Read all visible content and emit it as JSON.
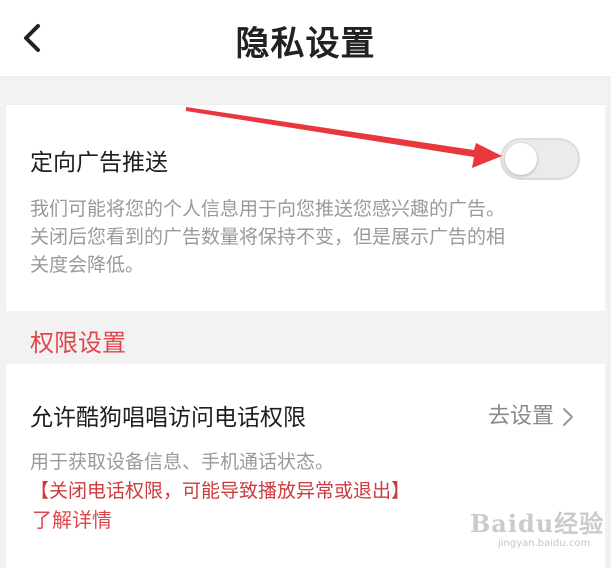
{
  "header": {
    "title": "隐私设置",
    "back_icon": "chevron-left-icon"
  },
  "ad_push": {
    "title": "定向广告推送",
    "toggle_on": false,
    "description_line1": "我们可能将您的个人信息用于向您推送您感兴趣的广告。",
    "description_line2": "关闭后您看到的广告数量将保持不变，但是展示广告的相",
    "description_line3": "关度会降低。"
  },
  "permissions_section": {
    "label": "权限设置",
    "label_color": "#e0474c"
  },
  "phone_permission": {
    "title": "允许酷狗唱唱访问电话权限",
    "action_label": "去设置",
    "action_icon": "chevron-right-icon",
    "description": "用于获取设备信息、手机通话状态。",
    "warning": "【关闭电话权限，可能导致播放异常或退出】",
    "learn_more": "了解详情"
  },
  "annotation": {
    "arrow_color": "#e8383d",
    "arrow_icon": "red-arrow-icon"
  },
  "watermark": {
    "brand": "Baidu经验",
    "url": "jingyan.baidu.com"
  }
}
